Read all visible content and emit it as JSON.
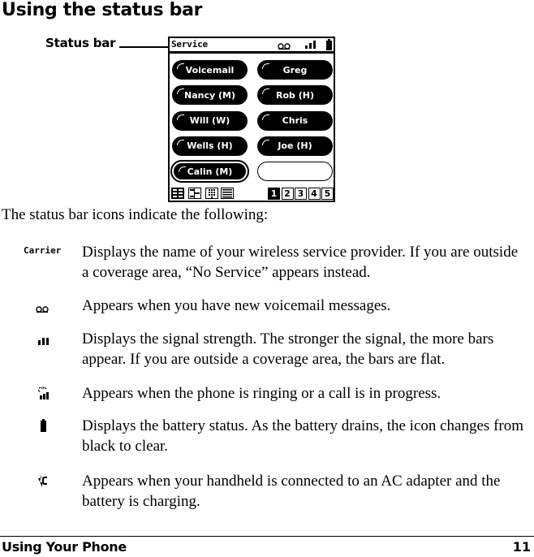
{
  "heading": "Using the status bar",
  "callout_label": "Status bar",
  "phone": {
    "carrier": "Service",
    "status_icons": [
      "voicemail-icon",
      "signal-strength-icon",
      "battery-icon"
    ],
    "speed_dial": [
      {
        "label": "Voicemail",
        "state": "filled"
      },
      {
        "label": "Greg",
        "state": "filled"
      },
      {
        "label": "Nancy (M)",
        "state": "filled"
      },
      {
        "label": "Rob (H)",
        "state": "filled"
      },
      {
        "label": "Will (W)",
        "state": "filled"
      },
      {
        "label": "Chris",
        "state": "filled"
      },
      {
        "label": "Wells (H)",
        "state": "filled"
      },
      {
        "label": "Joe (H)",
        "state": "filled"
      },
      {
        "label": "Calin (M)",
        "state": "selected"
      },
      {
        "label": "",
        "state": "empty"
      }
    ],
    "view_buttons": [
      "grid-view-icon",
      "list-view-icon",
      "keypad-view-icon",
      "lines-view-icon"
    ],
    "pages": [
      "1",
      "2",
      "3",
      "4",
      "5"
    ],
    "active_page": "1"
  },
  "intro": "The status bar icons indicate the following:",
  "items": [
    {
      "icon": "carrier-icon",
      "icon_text": "Carrier",
      "text": "Displays the name of your wireless service provider. If you are outside a coverage area, “No Service” appears instead."
    },
    {
      "icon": "voicemail-icon",
      "text": "Appears when you have new voicemail messages."
    },
    {
      "icon": "signal-strength-icon",
      "text": "Displays the signal strength. The stronger the signal, the more bars appear. If you are outside a coverage area, the bars are flat."
    },
    {
      "icon": "call-in-progress-icon",
      "text": "Appears when the phone is ringing or a call is in progress."
    },
    {
      "icon": "battery-icon",
      "text": "Displays the battery status. As the battery drains, the icon changes from black to clear."
    },
    {
      "icon": "charging-icon",
      "text": "Appears when your handheld is connected to an AC adapter and the battery is charging."
    }
  ],
  "footer": {
    "section": "Using Your Phone",
    "page_number": "11"
  }
}
